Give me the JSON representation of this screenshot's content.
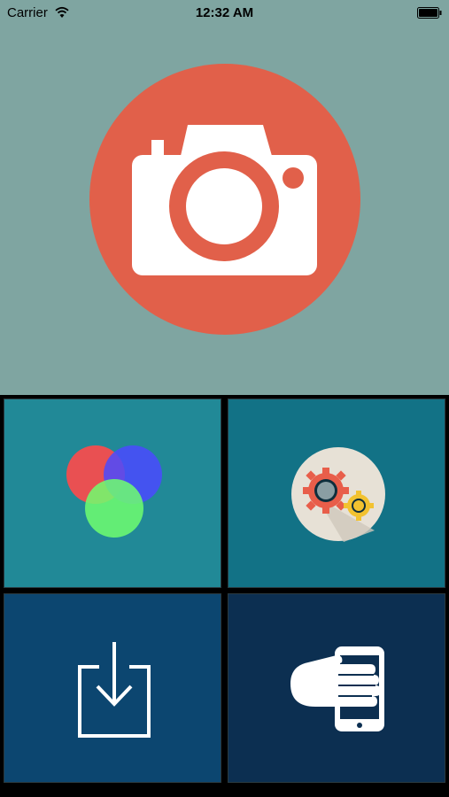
{
  "status_bar": {
    "carrier": "Carrier",
    "time": "12:32 AM"
  },
  "hero": {
    "background": "#7fa5a1",
    "circle_color": "#e1604a",
    "icon": "camera-icon"
  },
  "tiles": [
    {
      "name": "color-mix-tile",
      "icon": "rgb-circles-icon",
      "background": "#218997"
    },
    {
      "name": "settings-tile",
      "icon": "gears-icon",
      "background": "#127286"
    },
    {
      "name": "download-tile",
      "icon": "download-icon",
      "background": "#0c4670"
    },
    {
      "name": "phone-hand-tile",
      "icon": "hand-phone-icon",
      "background": "#0c2f51"
    }
  ]
}
